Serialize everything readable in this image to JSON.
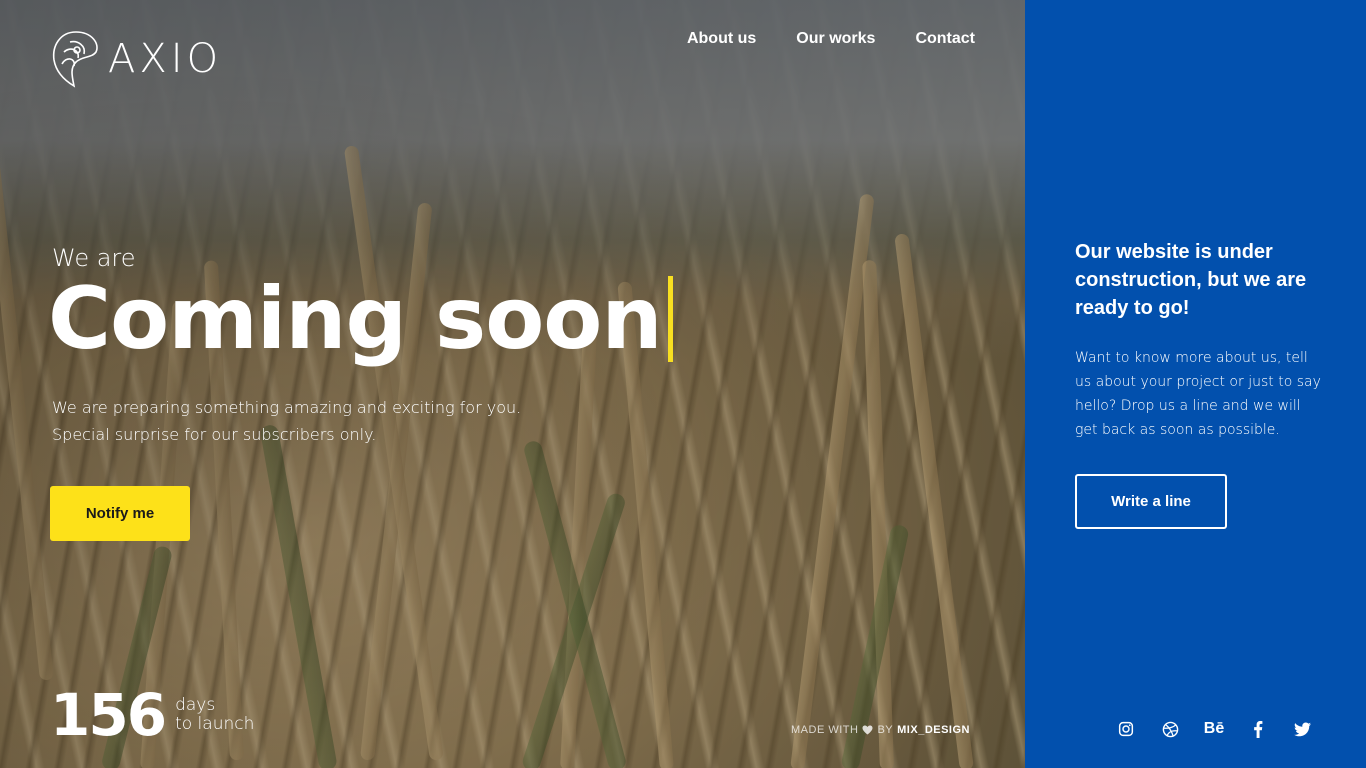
{
  "brand": {
    "name": "AXIO"
  },
  "nav": {
    "items": [
      {
        "label": "About us"
      },
      {
        "label": "Our works"
      },
      {
        "label": "Contact"
      }
    ]
  },
  "hero": {
    "eyebrow": "We are",
    "headline": "Coming soon",
    "subtitle_line1": "We are preparing something amazing and exciting for you.",
    "subtitle_line2": "Special surprise for our subscribers only.",
    "notify_label": "Notify me"
  },
  "countdown": {
    "value": "156",
    "unit_line1": "days",
    "unit_line2": "to launch"
  },
  "footer": {
    "made_with_prefix": "MADE WITH",
    "made_with_by": "BY",
    "made_with_brand": "MIX_DESIGN"
  },
  "panel": {
    "title": "Our website is under construction, but we are ready to go!",
    "text": "Want to know more about us, tell us about your project or just to say hello? Drop us a line and we will get back as soon as possible.",
    "write_label": "Write a line"
  },
  "socials": {
    "icons": [
      "instagram-icon",
      "dribbble-icon",
      "behance-icon",
      "facebook-icon",
      "twitter-icon"
    ],
    "behance_text": "Bē"
  },
  "colors": {
    "accent_yellow": "#fde119",
    "panel_blue": "#0250ad",
    "cursor_yellow": "#f8df21"
  }
}
